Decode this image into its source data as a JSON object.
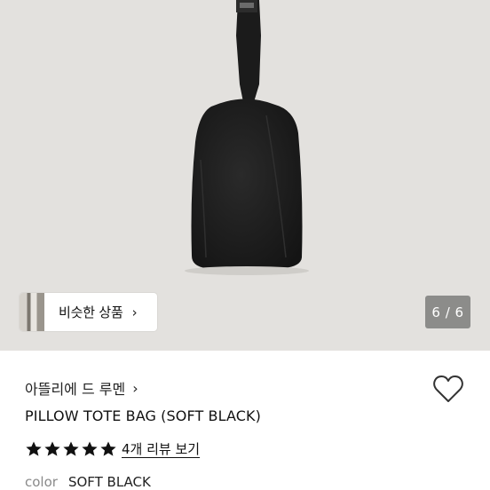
{
  "image": {
    "alt_icon": "pillow-tote-bag-side-view"
  },
  "similar": {
    "label": "비슷한 상품",
    "chevron": "›"
  },
  "counter": {
    "text": "6 / 6"
  },
  "product": {
    "brand": "아뜰리에 드 루멘",
    "brand_chevron": "›",
    "title": "PILLOW TOTE BAG (SOFT BLACK)",
    "rating": 5,
    "reviews_label": "4개 리뷰 보기",
    "color_key": "color",
    "color_value": "SOFT BLACK"
  },
  "colors": {
    "background_hero": "#e3e1de",
    "counter_bg": "#8c8c8a",
    "bag": "#1f1f1f"
  }
}
